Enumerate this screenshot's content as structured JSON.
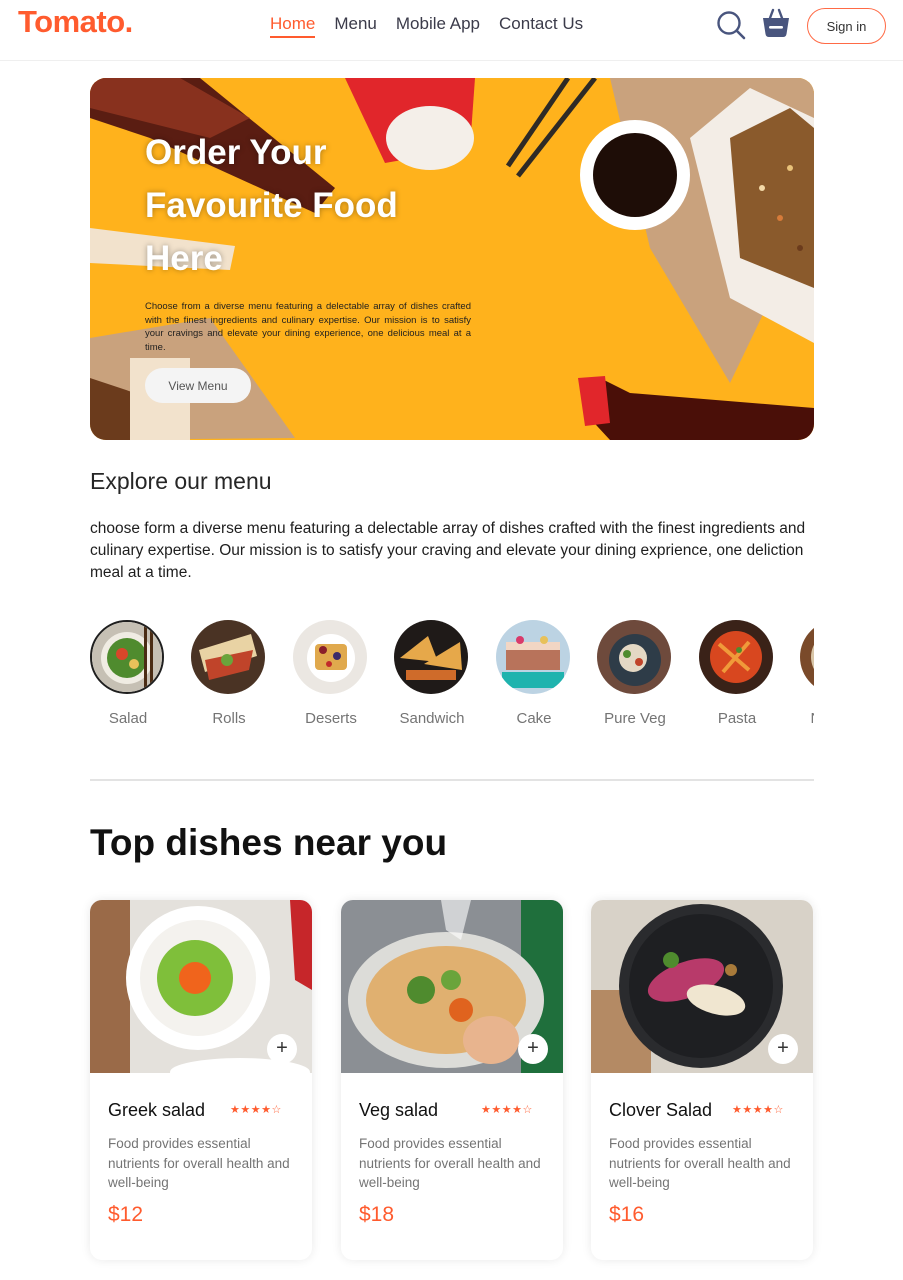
{
  "navbar": {
    "logo": "Tomato.",
    "links": [
      "Home",
      "Menu",
      "Mobile App",
      "Contact Us"
    ],
    "active_link": "Home",
    "sign_in_label": "Sign in",
    "icons": [
      "search-icon",
      "basket-icon"
    ]
  },
  "hero": {
    "title": "Order Your Favourite Food Here",
    "description": "Choose from a diverse menu featuring a delectable array of dishes crafted with the finest ingredients and culinary expertise. Our mission is to satisfy your cravings and elevate your dining experience, one delicious meal at a time.",
    "button_label": "View Menu"
  },
  "explore": {
    "title": "Explore our menu",
    "text": "choose form a diverse menu featuring a delectable array of dishes crafted with the finest ingredients and culinary expertise. Our mission is to satisfy your craving and elevate your dining exprience, one deliction meal at a time.",
    "items": [
      "Salad",
      "Rolls",
      "Deserts",
      "Sandwich",
      "Cake",
      "Pure Veg",
      "Pasta",
      "Noodles"
    ],
    "selected": "Salad"
  },
  "top_dishes": {
    "title": "Top dishes near you",
    "dishes": [
      {
        "name": "Greek salad",
        "rating": 4,
        "rating_stars": "★★★★☆",
        "description": "Food provides essential nutrients for overall health and well-being",
        "price": "$12"
      },
      {
        "name": "Veg salad",
        "rating": 4,
        "rating_stars": "★★★★☆",
        "description": "Food provides essential nutrients for overall health and well-being",
        "price": "$18"
      },
      {
        "name": "Clover Salad",
        "rating": 4,
        "rating_stars": "★★★★☆",
        "description": "Food provides essential nutrients for overall health and well-being",
        "price": "$16"
      }
    ],
    "add_label": "+"
  },
  "colors": {
    "accent": "#ff5b2e",
    "hero_background": "#ffb21c",
    "text_dark": "#262626",
    "text_muted": "#747474"
  }
}
